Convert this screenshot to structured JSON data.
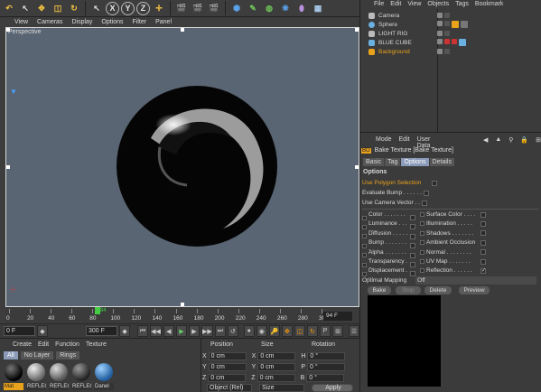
{
  "toolbar": {
    "axis": [
      "X",
      "Y",
      "Z"
    ]
  },
  "viewport": {
    "menu": [
      "View",
      "Cameras",
      "Display",
      "Options",
      "Filter",
      "Panel"
    ],
    "label": "Perspective"
  },
  "timeline": {
    "ticks": [
      "0",
      "20",
      "40",
      "60",
      "80",
      "100",
      "120",
      "140",
      "160",
      "180",
      "200",
      "220",
      "240",
      "260",
      "280",
      "300"
    ],
    "current": "84",
    "frame_display": "94 F"
  },
  "transport": {
    "start": "0 F",
    "end": "300 F"
  },
  "materials": {
    "menu": [
      "Create",
      "Edit",
      "Function",
      "Texture"
    ],
    "tabs": [
      "All",
      "No Layer",
      "Rings"
    ],
    "items": [
      "Mat",
      "REFLEC",
      "REFLEC",
      "REFLEC",
      "Danel"
    ]
  },
  "coords": {
    "headers": [
      "Position",
      "Size",
      "Rotation"
    ],
    "rows": [
      {
        "a": "X",
        "v1": "0 cm",
        "b": "X",
        "v2": "0 cm",
        "c": "H",
        "v3": "0 °"
      },
      {
        "a": "Y",
        "v1": "0 cm",
        "b": "Y",
        "v2": "0 cm",
        "c": "P",
        "v3": "0 °"
      },
      {
        "a": "Z",
        "v1": "0 cm",
        "b": "Z",
        "v2": "0 cm",
        "c": "B",
        "v3": "0 °"
      }
    ],
    "mode1": "Object (Rel)",
    "mode2": "Size",
    "apply": "Apply"
  },
  "objects": {
    "menu": [
      "File",
      "Edit",
      "View",
      "Objects",
      "Tags",
      "Bookmark"
    ],
    "items": [
      {
        "name": "Camera",
        "color": "#bbbbbb"
      },
      {
        "name": "Sphere",
        "color": "#6ab0e0"
      },
      {
        "name": "LIGHT RIG",
        "color": "#bbbbbb"
      },
      {
        "name": "BLUE CUBE",
        "color": "#6ab0e0"
      },
      {
        "name": "Background",
        "color": "#e9a21c"
      }
    ]
  },
  "attributes": {
    "menu": [
      "Mode",
      "Edit",
      "User Data"
    ],
    "title": "Bake Texture [Bake Texture]",
    "tabs": [
      "Basic",
      "Tag",
      "Options",
      "Details"
    ],
    "section": "Options",
    "top_options": [
      {
        "label": "Use Polygon Selection",
        "checked": false
      },
      {
        "label": "Evaluate Bump . . . . . .",
        "checked": false
      },
      {
        "label": "Use Camera Vector . .",
        "checked": false
      }
    ],
    "left_channels": [
      {
        "label": "Color . . . . . . . . .",
        "checked": false
      },
      {
        "label": "Luminance . . . . .",
        "checked": false
      },
      {
        "label": "Diffusion . . . . . .",
        "checked": false
      },
      {
        "label": "Bump . . . . . . . .",
        "checked": false
      },
      {
        "label": "Alpha . . . . . . . .",
        "checked": false
      },
      {
        "label": "Transparency . . .",
        "checked": false
      },
      {
        "label": "Displacement . . .",
        "checked": false
      }
    ],
    "right_channels": [
      {
        "label": "Surface Color . . . .",
        "checked": false
      },
      {
        "label": "Illumination . . . . .",
        "checked": false
      },
      {
        "label": "Shadows . . . . . . .",
        "checked": false
      },
      {
        "label": "Ambient Occlusion",
        "checked": false
      },
      {
        "label": "Normal . . . . . . . .",
        "checked": false
      },
      {
        "label": "UV Map . . . . . . .",
        "checked": false
      },
      {
        "label": "Reflection . . . . . .",
        "checked": true
      }
    ],
    "optimal_mapping_label": "Optimal Mapping",
    "optimal_mapping_value": "Off",
    "buttons": [
      "Bake",
      "Stop",
      "Delete",
      "Preview"
    ]
  }
}
